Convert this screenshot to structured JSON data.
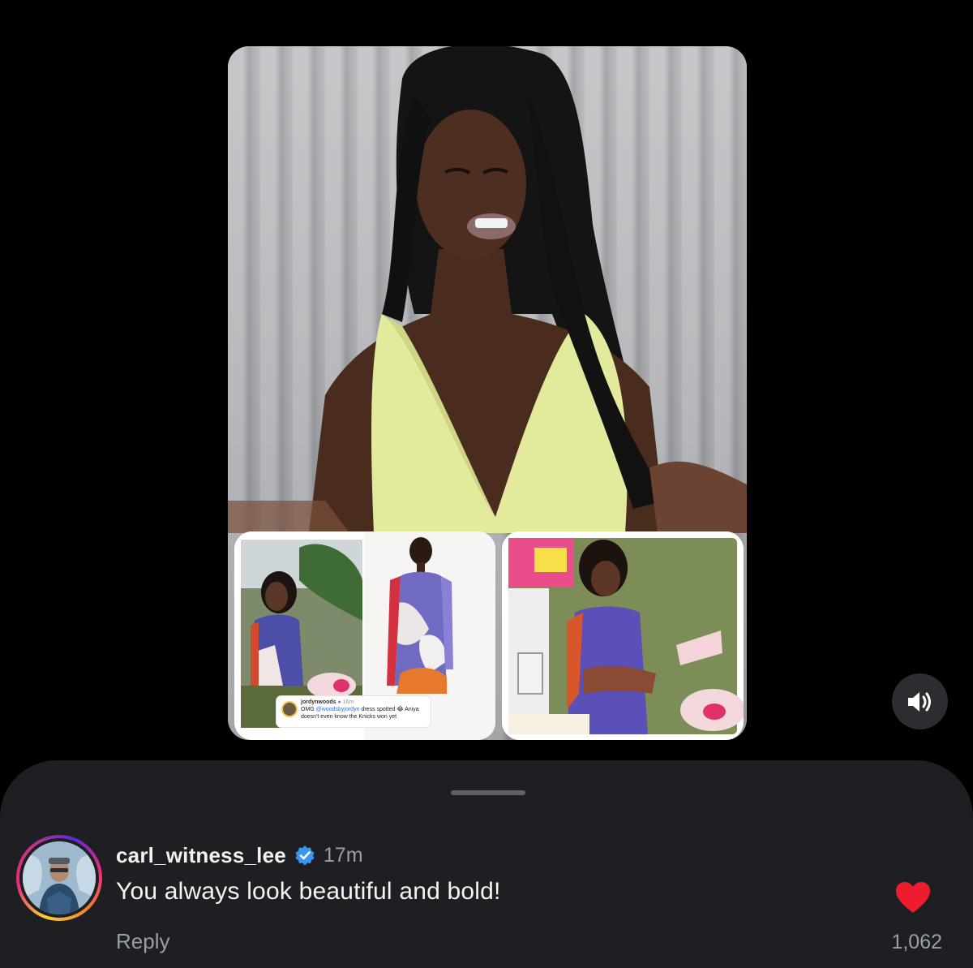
{
  "video": {
    "inset_tweet": {
      "handle": "jordynwoods",
      "time": "16m",
      "text_prefix": "OMG ",
      "mention": "@woodsbyjordyn",
      "text_suffix": " dress spotted 😂 Aniya doesn't even know the Knicks won yet"
    },
    "sound_icon": "speaker-on-icon"
  },
  "comment": {
    "username": "carl_witness_lee",
    "verified_icon": "verified-badge-icon",
    "timestamp": "17m",
    "text": "You always look beautiful and bold!",
    "reply_label": "Reply",
    "like_icon": "heart-filled-icon",
    "like_count": "1,062"
  },
  "colors": {
    "background": "#000000",
    "sheet": "#1d1f22",
    "secondary_text": "#9a9ea5",
    "like": "#ed1c2e",
    "verified": "#3797f0"
  }
}
